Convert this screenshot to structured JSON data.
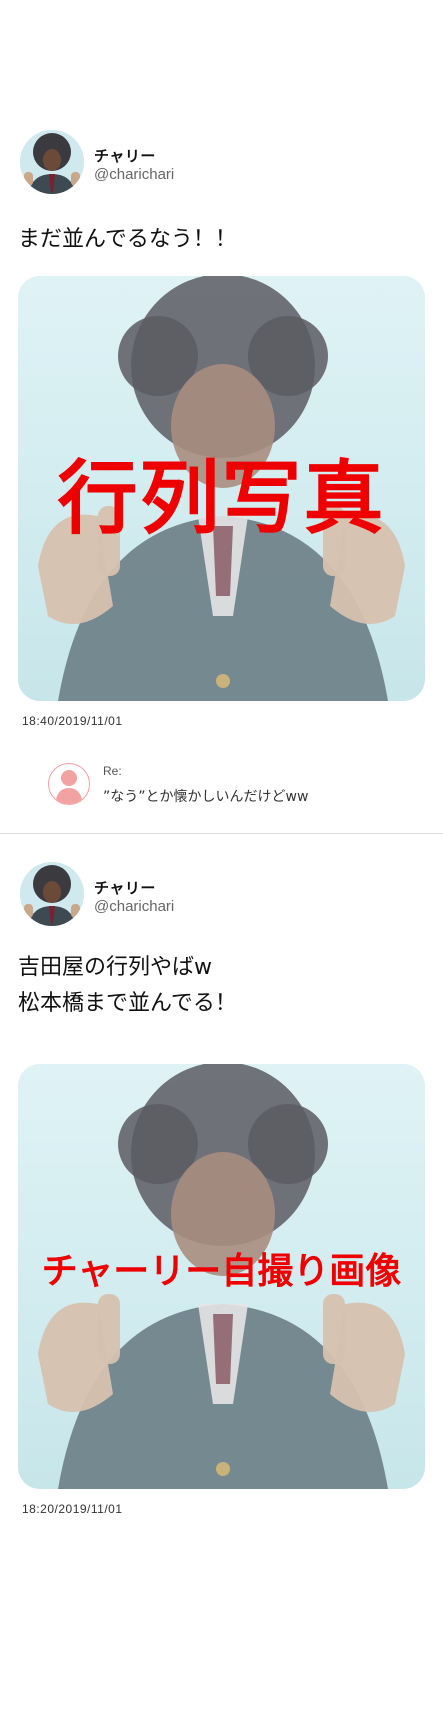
{
  "posts": [
    {
      "user": {
        "name": "チャリー",
        "handle": "@charichari"
      },
      "text": "まだ並んでるなう！！",
      "photo": {
        "overlay_text": "行列写真",
        "overlay_color": "#ee0000"
      },
      "timestamp": "18:40/2019/11/01",
      "reply": {
        "label": "Re:",
        "text": "”なう”とか懐かしいんだけどww"
      }
    },
    {
      "user": {
        "name": "チャリー",
        "handle": "@charichari"
      },
      "text": "吉田屋の行列やばw\n松本橋まで並んでる！",
      "photo": {
        "overlay_text": "チャーリー自撮り画像",
        "overlay_color": "#ee0000"
      },
      "timestamp": "18:20/2019/11/01"
    }
  ],
  "colors": {
    "overlay_red": "#ee0000",
    "reply_avatar_pink": "#f3a2a2",
    "photo_sky": "#d6f0f4"
  }
}
